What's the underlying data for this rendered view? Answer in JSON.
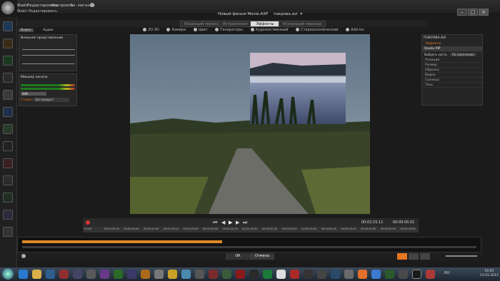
{
  "menu": [
    "Файл",
    "Редактировать",
    "Настроить",
    "Эл. магазин"
  ],
  "submenu": [
    "Файл",
    "Редактировать"
  ],
  "doc_title": "Новый фильм Movie.AXP",
  "doc_file": "покрова.avi",
  "tabs": [
    "Входящий переход",
    "Исправления",
    "Эффекты",
    "Исходящий переход"
  ],
  "active_tab": "Эффекты",
  "subtoolbar": [
    "2D-3D",
    "Камера",
    "Цвет",
    "Генераторы",
    "Художественный",
    "Стереоскопический",
    "Add-ins"
  ],
  "left_panel": {
    "header": {
      "video": "Видео",
      "audio": "Аудио"
    },
    "waveform_title": "Внешнее представление",
    "mixer_title": "Микшер канала",
    "mixer_value": "0dB",
    "stereo_label": "Стерео",
    "stereo_value": "Зал.предуст"
  },
  "right_panel": {
    "title": "ПОКРОВА.AVI",
    "effects_label": "Эффекты",
    "effect_name": "Studio PIP",
    "preset_label": "Выбрать настр.",
    "preset_value": "По умолчанию",
    "sections": [
      "Позиция",
      "Размер",
      "Обрезка",
      "Видео",
      "Граница",
      "Тень"
    ]
  },
  "transport": {
    "timecode": "00:02:15.11",
    "end": "00:00:00.01",
    "ruler": [
      "00:00",
      "00:00:20.00",
      "00:00:40.00",
      "00:01:00.00",
      "00:01:20.00",
      "00:01:40.00",
      "00:02:00.00",
      "00:02:20.00",
      "00:02:40.00",
      "00:03:00.00",
      "00:03:20.00",
      "00:03:40.00",
      "00:04:00.00",
      "00:04:20.00",
      "00:04:40.00",
      "00:05:00.00",
      "00:05:20.00"
    ]
  },
  "buttons": {
    "ok": "ОК",
    "cancel": "Отмена"
  },
  "timeline_progress": 0.44,
  "clock": {
    "time": "16:05",
    "date": "13.01.2013",
    "lang": "RU"
  },
  "colors": {
    "accent": "#e87722",
    "panel": "#252525",
    "timeline": "#e0882a"
  }
}
